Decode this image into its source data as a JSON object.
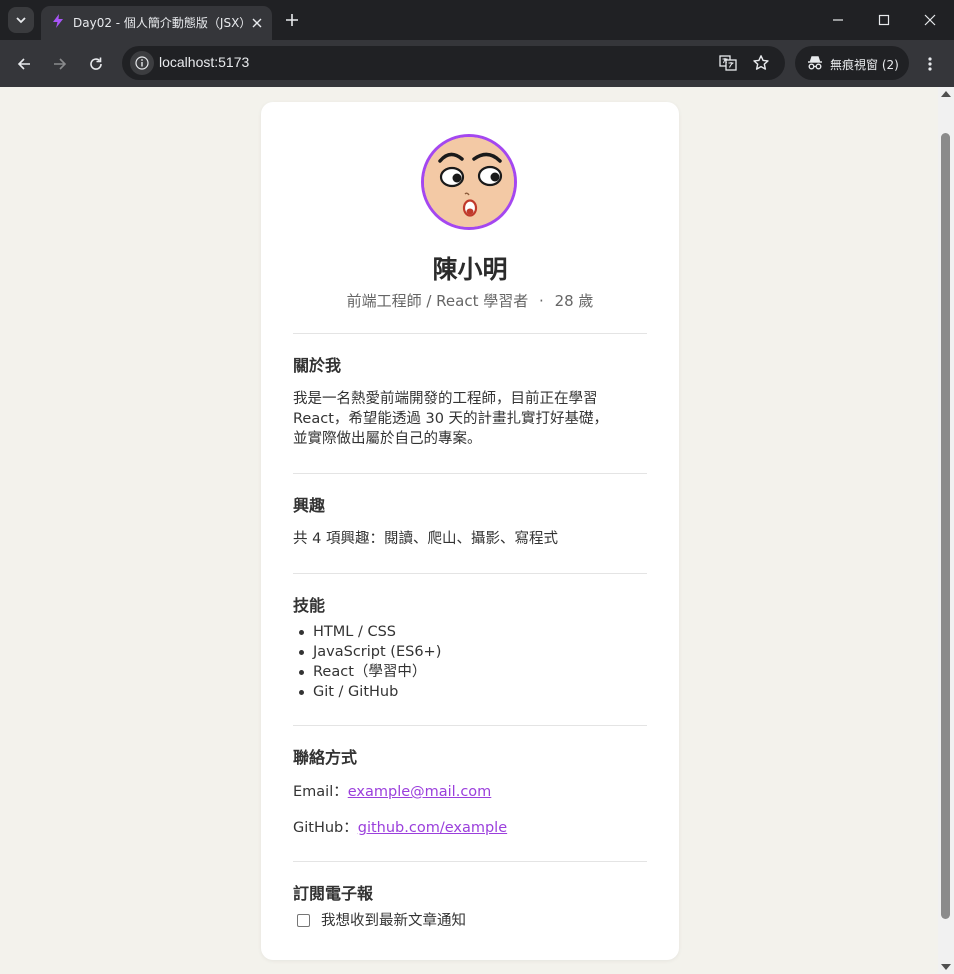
{
  "browser": {
    "tab_title": "Day02 - 個人簡介動態版（JSX）",
    "url": "localhost:5173",
    "incognito_label": "無痕視窗 (2)"
  },
  "profile": {
    "name": "陳小明",
    "title": "前端工程師 / React 學習者",
    "separator": "·",
    "age": "28 歲"
  },
  "about": {
    "heading": "關於我",
    "lines": [
      "我是一名熱愛前端開發的工程師，目前正在學習",
      "React，希望能透過 30 天的計畫扎實打好基礎，",
      "並實際做出屬於自己的專案。"
    ]
  },
  "interests": {
    "heading": "興趣",
    "summary": "共 4 項興趣：閱讀、爬山、攝影、寫程式"
  },
  "skills": {
    "heading": "技能",
    "items": [
      "HTML / CSS",
      "JavaScript (ES6+)",
      "React（學習中）",
      "Git / GitHub"
    ]
  },
  "contact": {
    "heading": "聯絡方式",
    "email_label": "Email：",
    "email": "example@mail.com",
    "github_label": "GitHub：",
    "github": "github.com/example"
  },
  "newsletter": {
    "heading": "訂閱電子報",
    "checkbox_label": "我想收到最新文章通知",
    "checked": false
  },
  "colors": {
    "accent": "#a447f0",
    "link": "#9b3fdc",
    "page_bg": "#f3f2ec"
  }
}
